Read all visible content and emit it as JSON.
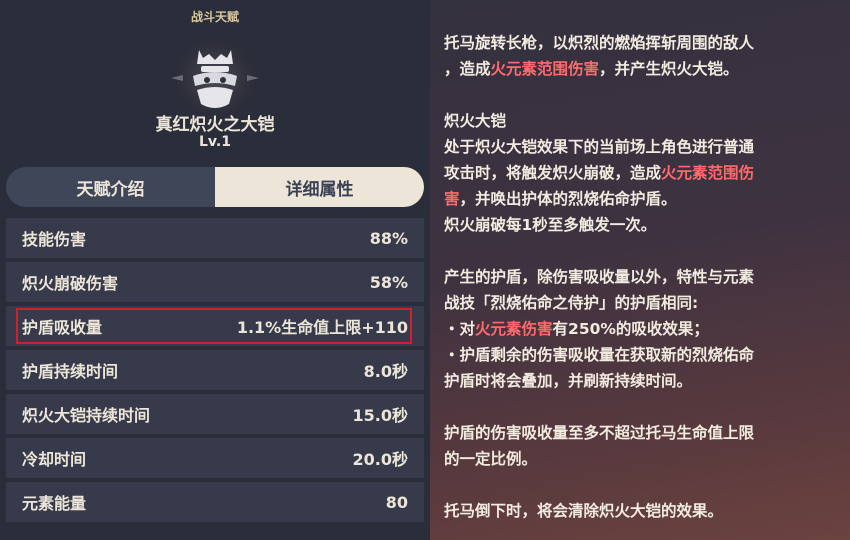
{
  "header": {
    "category": "战斗天赋",
    "skill_name": "真红炽火之大铠",
    "level": "Lv.1"
  },
  "tabs": [
    {
      "label": "天赋介绍",
      "active": false
    },
    {
      "label": "详细属性",
      "active": true
    }
  ],
  "stats": [
    {
      "label": "技能伤害",
      "value": "88%"
    },
    {
      "label": "炽火崩破伤害",
      "value": "58%"
    },
    {
      "label": "护盾吸收量",
      "value": "1.1%生命值上限+110",
      "highlighted": true
    },
    {
      "label": "护盾持续时间",
      "value": "8.0秒"
    },
    {
      "label": "炽火大铠持续时间",
      "value": "15.0秒"
    },
    {
      "label": "冷却时间",
      "value": "20.0秒"
    },
    {
      "label": "元素能量",
      "value": "80"
    }
  ],
  "description": {
    "p1": [
      "托马旋转长枪，以炽烈的燃焰挥斩周围的敌人",
      "，造成",
      "火元素范围伤害",
      "，并产生炽火大铠。"
    ],
    "heading": "炽火大铠",
    "p2": [
      "处于炽火大铠效果下的当前场上角色进行普通",
      "攻击时，将触发炽火崩破，造成",
      "火元素范围伤",
      "害",
      "，并唤出护体的烈烧佑命护盾。",
      "炽火崩破每1秒至多触发一次。"
    ],
    "p3": [
      "产生的护盾，除伤害吸收量以外，特性与元素",
      "战技「烈烧佑命之侍护」的护盾相同:",
      "・对",
      "火元素伤害",
      "有250%的吸收效果；",
      "・护盾剩余的伤害吸收量在获取新的烈烧佑命",
      "护盾时将会叠加，并刷新持续时间。"
    ],
    "p4": [
      "护盾的伤害吸收量至多不超过托马生命值上限",
      "的一定比例。"
    ],
    "p5": "托马倒下时，将会清除炽火大铠的效果。"
  },
  "colors": {
    "pyro_text": "#ff6b6b",
    "heading_gold": "#ffd05a",
    "highlight_border": "#d0202a"
  }
}
